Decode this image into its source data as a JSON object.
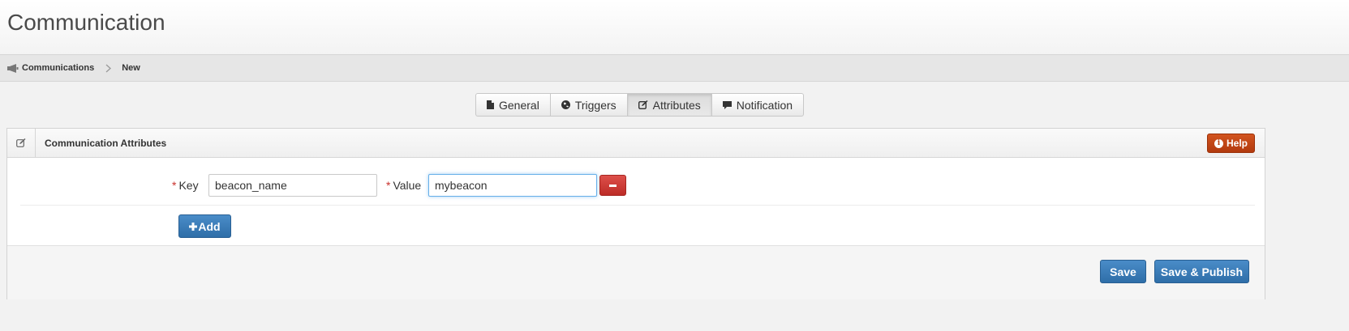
{
  "header": {
    "title": "Communication"
  },
  "breadcrumb": {
    "icon": "megaphone-icon",
    "items": [
      "Communications",
      "New"
    ]
  },
  "tabs": [
    {
      "label": "General",
      "icon": "document-icon",
      "active": false
    },
    {
      "label": "Triggers",
      "icon": "globe-icon",
      "active": false
    },
    {
      "label": "Attributes",
      "icon": "edit-icon",
      "active": true
    },
    {
      "label": "Notification",
      "icon": "comment-icon",
      "active": false
    }
  ],
  "panel": {
    "icon": "edit-icon",
    "title": "Communication Attributes",
    "help_label": "Help",
    "fields": {
      "required_mark": "*",
      "key_label": "Key",
      "key_value": "beacon_name",
      "value_label": "Value",
      "value_value": "mybeacon"
    },
    "add_label": "Add"
  },
  "footer": {
    "save_label": "Save",
    "publish_label": "Save & Publish"
  },
  "colors": {
    "primary": "#3a7bb8",
    "danger": "#c9302c",
    "help": "#c44a17",
    "focus": "#66afe9"
  }
}
